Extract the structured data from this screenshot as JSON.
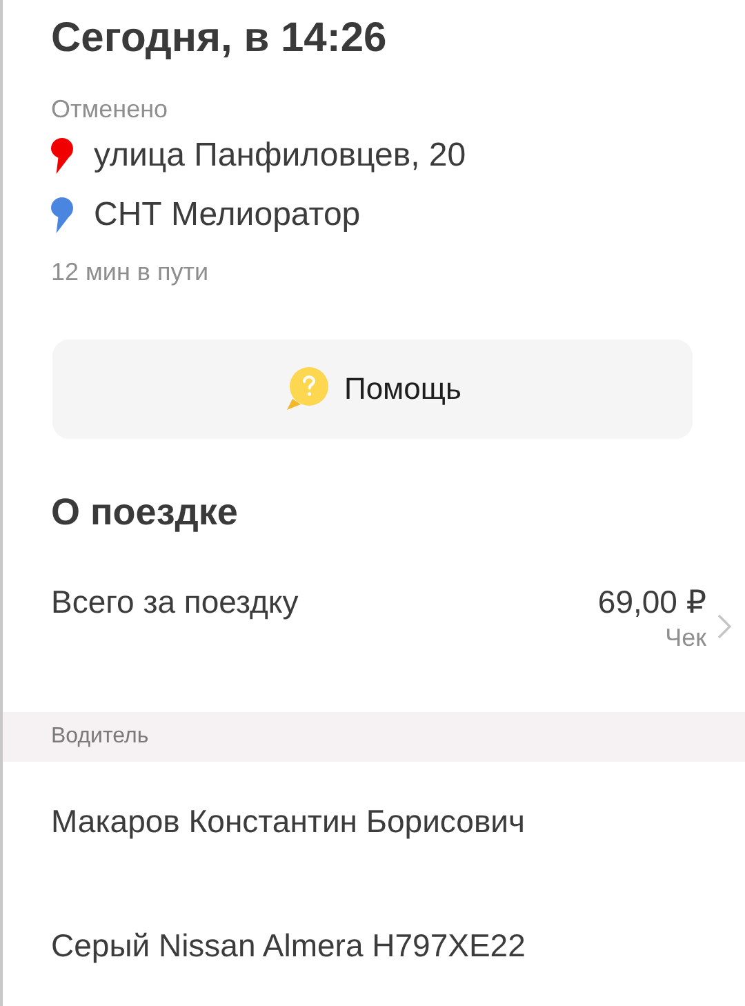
{
  "title": "Сегодня, в 14:26",
  "status": "Отменено",
  "route": [
    {
      "address": "улица Панфиловцев, 20",
      "color": "#f00000"
    },
    {
      "address": "СНТ Мелиоратор",
      "color": "#4a86e0"
    }
  ],
  "duration": "12 мин в пути",
  "help_button": {
    "label": "Помощь"
  },
  "trip_section": {
    "title": "О поездке",
    "total_label": "Всего за поездку",
    "total_value": "69,00 ₽",
    "receipt_link": "Чек"
  },
  "driver_section": {
    "header": "Водитель",
    "name": "Макаров Константин Борисович",
    "car": "Серый Nissan Almera Н797ХЕ22"
  }
}
